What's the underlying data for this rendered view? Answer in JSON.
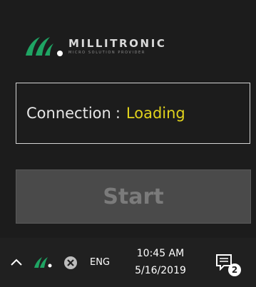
{
  "app": {
    "brand_name": "MILLITRONIC",
    "tagline": "micro solution provider"
  },
  "connection": {
    "label": "Connection",
    "separator": ":",
    "status": "Loading"
  },
  "start_button": {
    "label": "Start"
  },
  "taskbar": {
    "language": "ENG",
    "time": "10:45 AM",
    "date": "5/16/2019",
    "notification_count": "2",
    "icons": [
      "chevron-up-icon",
      "millitronic-tray-icon",
      "close-circle-icon",
      "notification-icon"
    ]
  },
  "colors": {
    "window_bg": "#1c1c1c",
    "taskbar_bg": "#202020",
    "brand_green": "#1fa463",
    "status_yellow": "#e0d21c",
    "button_disabled_bg": "#4a4a4a",
    "button_disabled_text": "#7b7b7b"
  }
}
